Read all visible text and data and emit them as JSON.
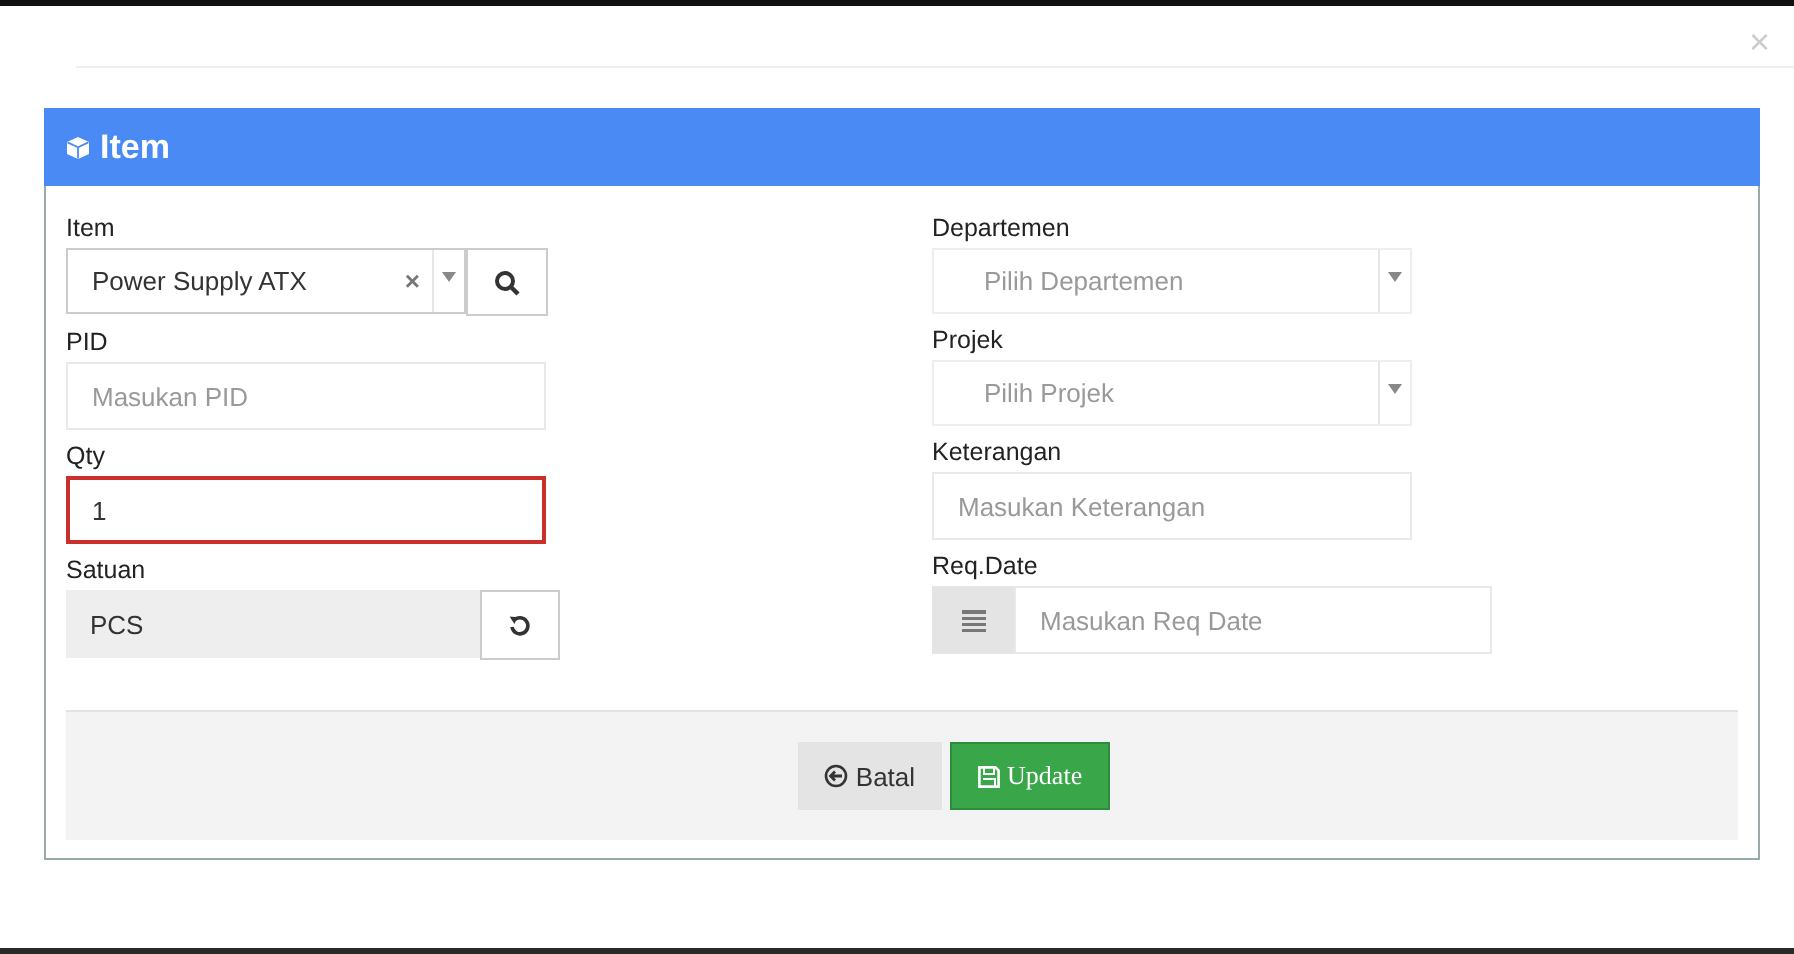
{
  "modal": {
    "close": "×"
  },
  "panel": {
    "title": "Item"
  },
  "left_fields": [
    {
      "kind": "select-search",
      "label": "Item",
      "value": "Power Supply ATX",
      "clear": "×",
      "error": false
    },
    {
      "kind": "input",
      "label": "PID",
      "placeholder": "Masukan PID",
      "error": false
    },
    {
      "kind": "input",
      "label": "Qty",
      "value": "1",
      "error": true
    },
    {
      "kind": "readonly-refresh",
      "label": "Satuan",
      "value": "PCS",
      "error": false
    }
  ],
  "right_fields": [
    {
      "kind": "select",
      "label": "Departemen",
      "placeholder": "Pilih Departemen",
      "error": false
    },
    {
      "kind": "select",
      "label": "Projek",
      "placeholder": "Pilih Projek",
      "error": false
    },
    {
      "kind": "input",
      "label": "Keterangan",
      "placeholder": "Masukan Keterangan",
      "error": false
    },
    {
      "kind": "date",
      "label": "Req.Date",
      "placeholder": "Masukan Req Date",
      "error": false
    }
  ],
  "buttons": [
    {
      "kind": "cancel",
      "label": "Batal"
    },
    {
      "kind": "save",
      "label": "Update"
    }
  ]
}
